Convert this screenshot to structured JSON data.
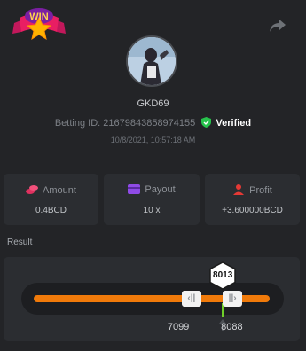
{
  "badge": {
    "text": "WIN"
  },
  "user": {
    "name": "GKD69",
    "betting_label": "Betting ID:",
    "betting_id": "21679843858974155",
    "verified_label": "Verified",
    "timestamp": "10/8/2021, 10:57:18 AM"
  },
  "stats": [
    {
      "label": "Amount",
      "value": "0.4BCD",
      "icon": "coins-icon"
    },
    {
      "label": "Payout",
      "value": "10 x",
      "icon": "card-icon"
    },
    {
      "label": "Profit",
      "value": "+3.600000BCD",
      "icon": "profit-icon"
    }
  ],
  "result": {
    "label": "Result",
    "result_value": "8013",
    "range_low": "7099",
    "range_high": "8088",
    "thumb_left_glyph": "‹||",
    "thumb_right_glyph": "||›",
    "scale_max": 10000
  },
  "colors": {
    "accent": "#f07a0a",
    "verified": "#27c24c",
    "marker": "#6fcf2a"
  }
}
